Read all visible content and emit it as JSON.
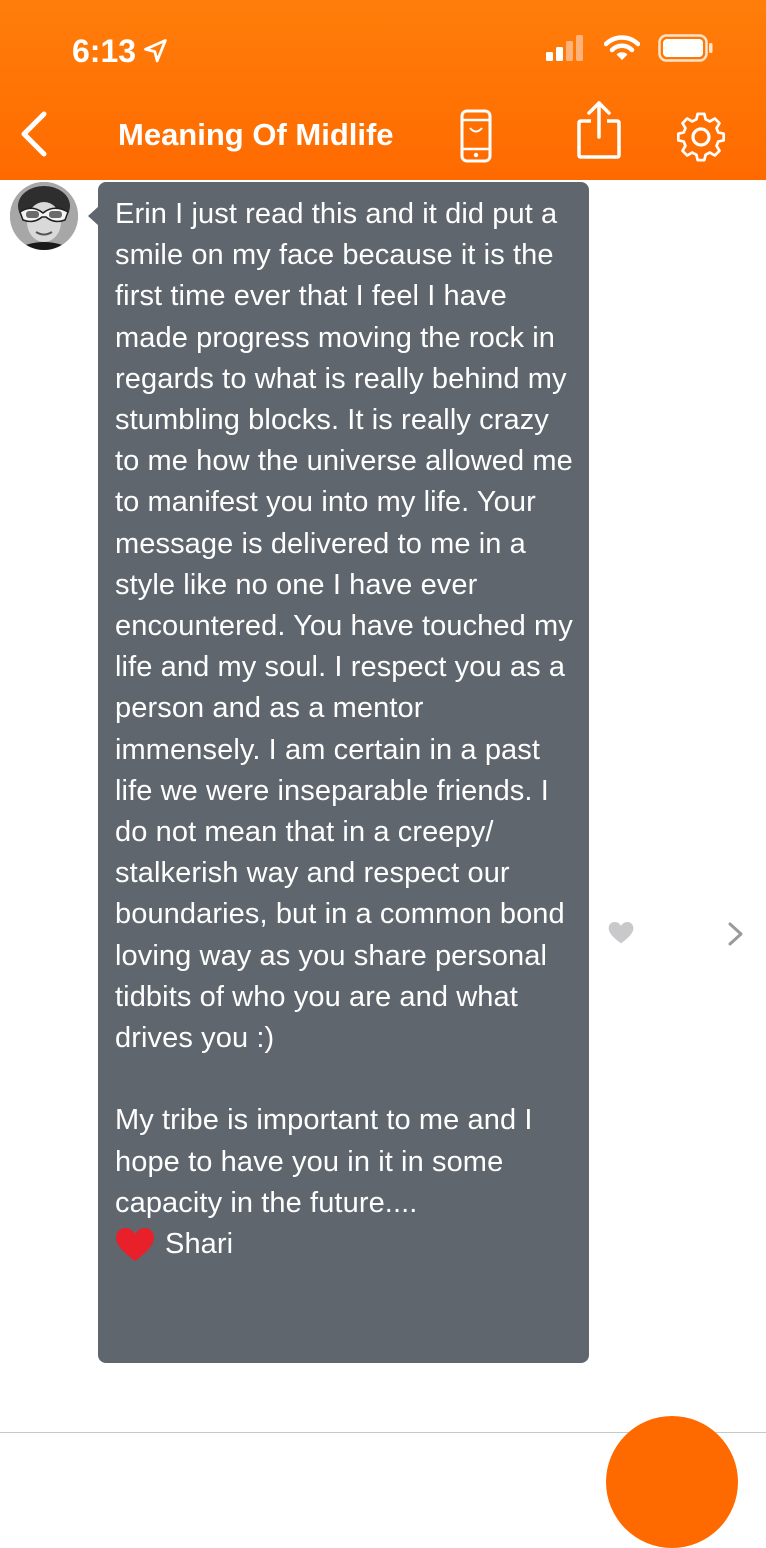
{
  "status_bar": {
    "time": "6:13"
  },
  "nav": {
    "title": "Meaning Of Midlife"
  },
  "message": {
    "paragraph1": "Erin I just read this and it did put a smile on my face because it is the first time ever that I feel I have made progress moving the rock in regards to what is really behind my stumbling blocks. It is really crazy to me how the universe allowed me to manifest you into my life. Your message is delivered to me in a style like no one I have ever encountered. You have touched my life and my soul. I respect you as a person and as a mentor immensely. I am certain in a past life we were inseparable friends. I do not mean that in a creepy/ stalkerish way and respect our boundaries, but in a common bond loving way as you share personal tidbits of who you are and what drives you :)",
    "paragraph2": "My tribe is important to me and I hope to have you in it in some capacity in the future....",
    "signoff": "Shari"
  },
  "colors": {
    "accent": "#ff6a00",
    "bubble": "#5f666e",
    "heart_red": "#e8202a",
    "like_heart": "#c9c9cc"
  }
}
